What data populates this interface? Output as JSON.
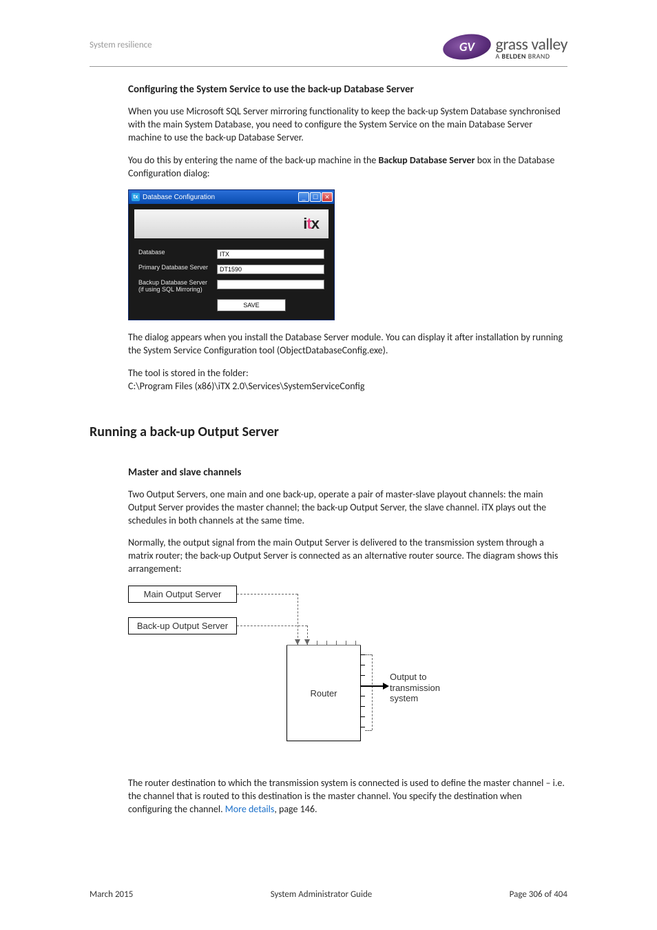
{
  "header": {
    "section": "System resilience",
    "brand_main": "grass valley",
    "brand_sub_prefix": "A ",
    "brand_sub_bold": "BELDEN",
    "brand_sub_suffix": " BRAND"
  },
  "section1": {
    "heading": "Configuring the System Service to use the back-up Database Server",
    "p1": "When you use Microsoft SQL Server mirroring functionality to keep the back-up System Database synchronised with the main System Database, you need to configure the System Service on the main Database Server machine to use the back-up Database Server.",
    "p2_a": "You do this by entering the name of the back-up machine in the ",
    "p2_bold": "Backup Database Server",
    "p2_b": " box in the Database Configuration dialog:"
  },
  "dialog": {
    "title": "Database Configuration",
    "icon_glyph": "itx",
    "banner_logo_pre": "i",
    "banner_logo_dot": "t",
    "banner_logo_post": "x",
    "labels": {
      "database": "Database",
      "primary": "Primary Database Server",
      "backup": "Backup Database Server (if using SQL Mirroring)"
    },
    "values": {
      "database": "ITX",
      "primary": "DT1590",
      "backup": ""
    },
    "save": "SAVE"
  },
  "section1b": {
    "p3": "The dialog appears when you install the Database Server module. You can display it after installation by running the System Service Configuration tool (ObjectDatabaseConfig.exe).",
    "p4a": "The tool is stored in the folder:",
    "p4b": "C:\\Program Files (x86)\\iTX 2.0\\Services\\SystemServiceConfig"
  },
  "section2": {
    "heading": "Running a back-up Output Server",
    "subheading": "Master and slave channels",
    "p1": "Two Output Servers, one main and one back-up, operate a pair of master-slave playout channels: the main Output Server provides the master channel; the back-up Output Server, the slave channel. iTX plays out the schedules in both channels at the same time.",
    "p2": "Normally, the output signal from the main Output Server is delivered to the transmission system through a matrix router; the back-up Output Server is connected as an alternative router source. The diagram shows this arrangement:"
  },
  "chart_data": {
    "type": "diagram",
    "nodes": [
      {
        "id": "main",
        "label": "Main Output Server"
      },
      {
        "id": "backup",
        "label": "Back-up Output Server"
      },
      {
        "id": "router",
        "label": "Router"
      },
      {
        "id": "output",
        "label": "Output to transmission system"
      }
    ],
    "edges": [
      {
        "from": "main",
        "to": "router",
        "style": "dashed"
      },
      {
        "from": "backup",
        "to": "router",
        "style": "dashed"
      },
      {
        "from": "router",
        "to": "output",
        "style": "solid-arrow"
      }
    ]
  },
  "section2b": {
    "p3_a": "The router destination to which the transmission system is connected is used to define the master channel – i.e. the channel that is routed to this destination is the master channel. You specify the destination when configuring the channel. ",
    "p3_link": "More details",
    "p3_b": ", page 146."
  },
  "footer": {
    "left": "March 2015",
    "center": "System Administrator Guide",
    "right": "Page 306 of 404"
  }
}
